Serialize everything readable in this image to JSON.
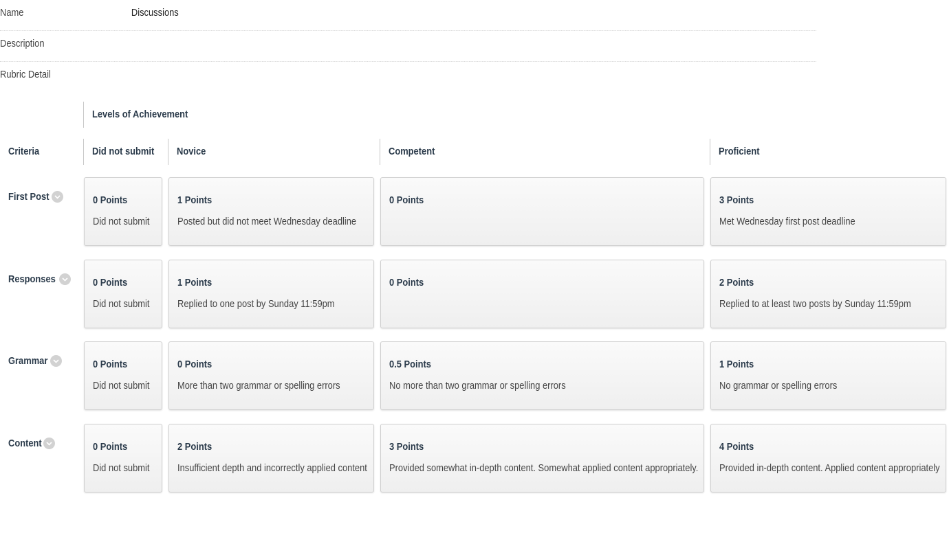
{
  "meta": {
    "name_label": "Name",
    "name_value": "Discussions",
    "description_label": "Description",
    "rubric_detail_label": "Rubric Detail"
  },
  "rubric": {
    "levels_title": "Levels of Achievement",
    "criteria_header": "Criteria",
    "levels": [
      "Did not submit",
      "Novice",
      "Competent",
      "Proficient"
    ],
    "rows": [
      {
        "criterion": "First Post",
        "cells": [
          {
            "points": "0 Points",
            "description": "Did not submit"
          },
          {
            "points": "1 Points",
            "description": "Posted but did not meet Wednesday deadline"
          },
          {
            "points": "0 Points",
            "description": ""
          },
          {
            "points": "3 Points",
            "description": "Met Wednesday first post deadline"
          }
        ]
      },
      {
        "criterion": "Responses",
        "cells": [
          {
            "points": "0 Points",
            "description": "Did not submit"
          },
          {
            "points": "1 Points",
            "description": "Replied to one post by Sunday 11:59pm"
          },
          {
            "points": "0 Points",
            "description": ""
          },
          {
            "points": "2 Points",
            "description": "Replied to at least two posts by Sunday 11:59pm"
          }
        ]
      },
      {
        "criterion": "Grammar",
        "cells": [
          {
            "points": "0 Points",
            "description": "Did not submit"
          },
          {
            "points": "0 Points",
            "description": "More than two grammar or spelling errors"
          },
          {
            "points": "0.5 Points",
            "description": "No more than two grammar or spelling errors"
          },
          {
            "points": "1 Points",
            "description": "No grammar or spelling errors"
          }
        ]
      },
      {
        "criterion": "Content",
        "cells": [
          {
            "points": "0 Points",
            "description": "Did not submit"
          },
          {
            "points": "2 Points",
            "description": "Insufficient depth and incorrectly applied content"
          },
          {
            "points": "3 Points",
            "description": "Provided somewhat in-depth content. Somewhat applied content appropriately."
          },
          {
            "points": "4 Points",
            "description": "Provided in-depth content. Applied content appropriately"
          }
        ]
      }
    ],
    "expand_icon": "chevron-down-icon"
  },
  "colors": {
    "heading": "#2a3a4a",
    "cell_background": "#f2f2f2",
    "cell_border": "#d0d0d0",
    "chevron_badge": "#d2d2d2"
  }
}
